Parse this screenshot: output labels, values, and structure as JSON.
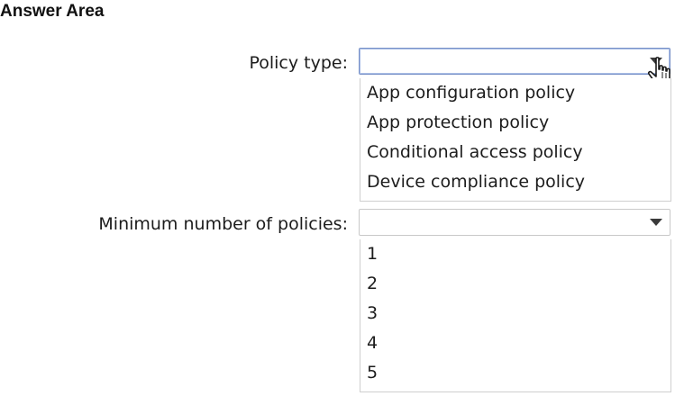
{
  "answer_area": {
    "title": "Answer Area"
  },
  "policy_type": {
    "label": "Policy type:",
    "selected": "",
    "options": [
      "App configuration policy",
      "App protection policy",
      "Conditional access policy",
      "Device compliance policy"
    ]
  },
  "min_policies": {
    "label": "Minimum number of policies:",
    "selected": "",
    "options": [
      "1",
      "2",
      "3",
      "4",
      "5"
    ]
  },
  "icons": {
    "dropdown_arrow": "chevron-down-icon",
    "cursor": "hand-pointer-icon"
  },
  "colors": {
    "focus_border": "#7a93c8",
    "border": "#c9c9c9"
  }
}
